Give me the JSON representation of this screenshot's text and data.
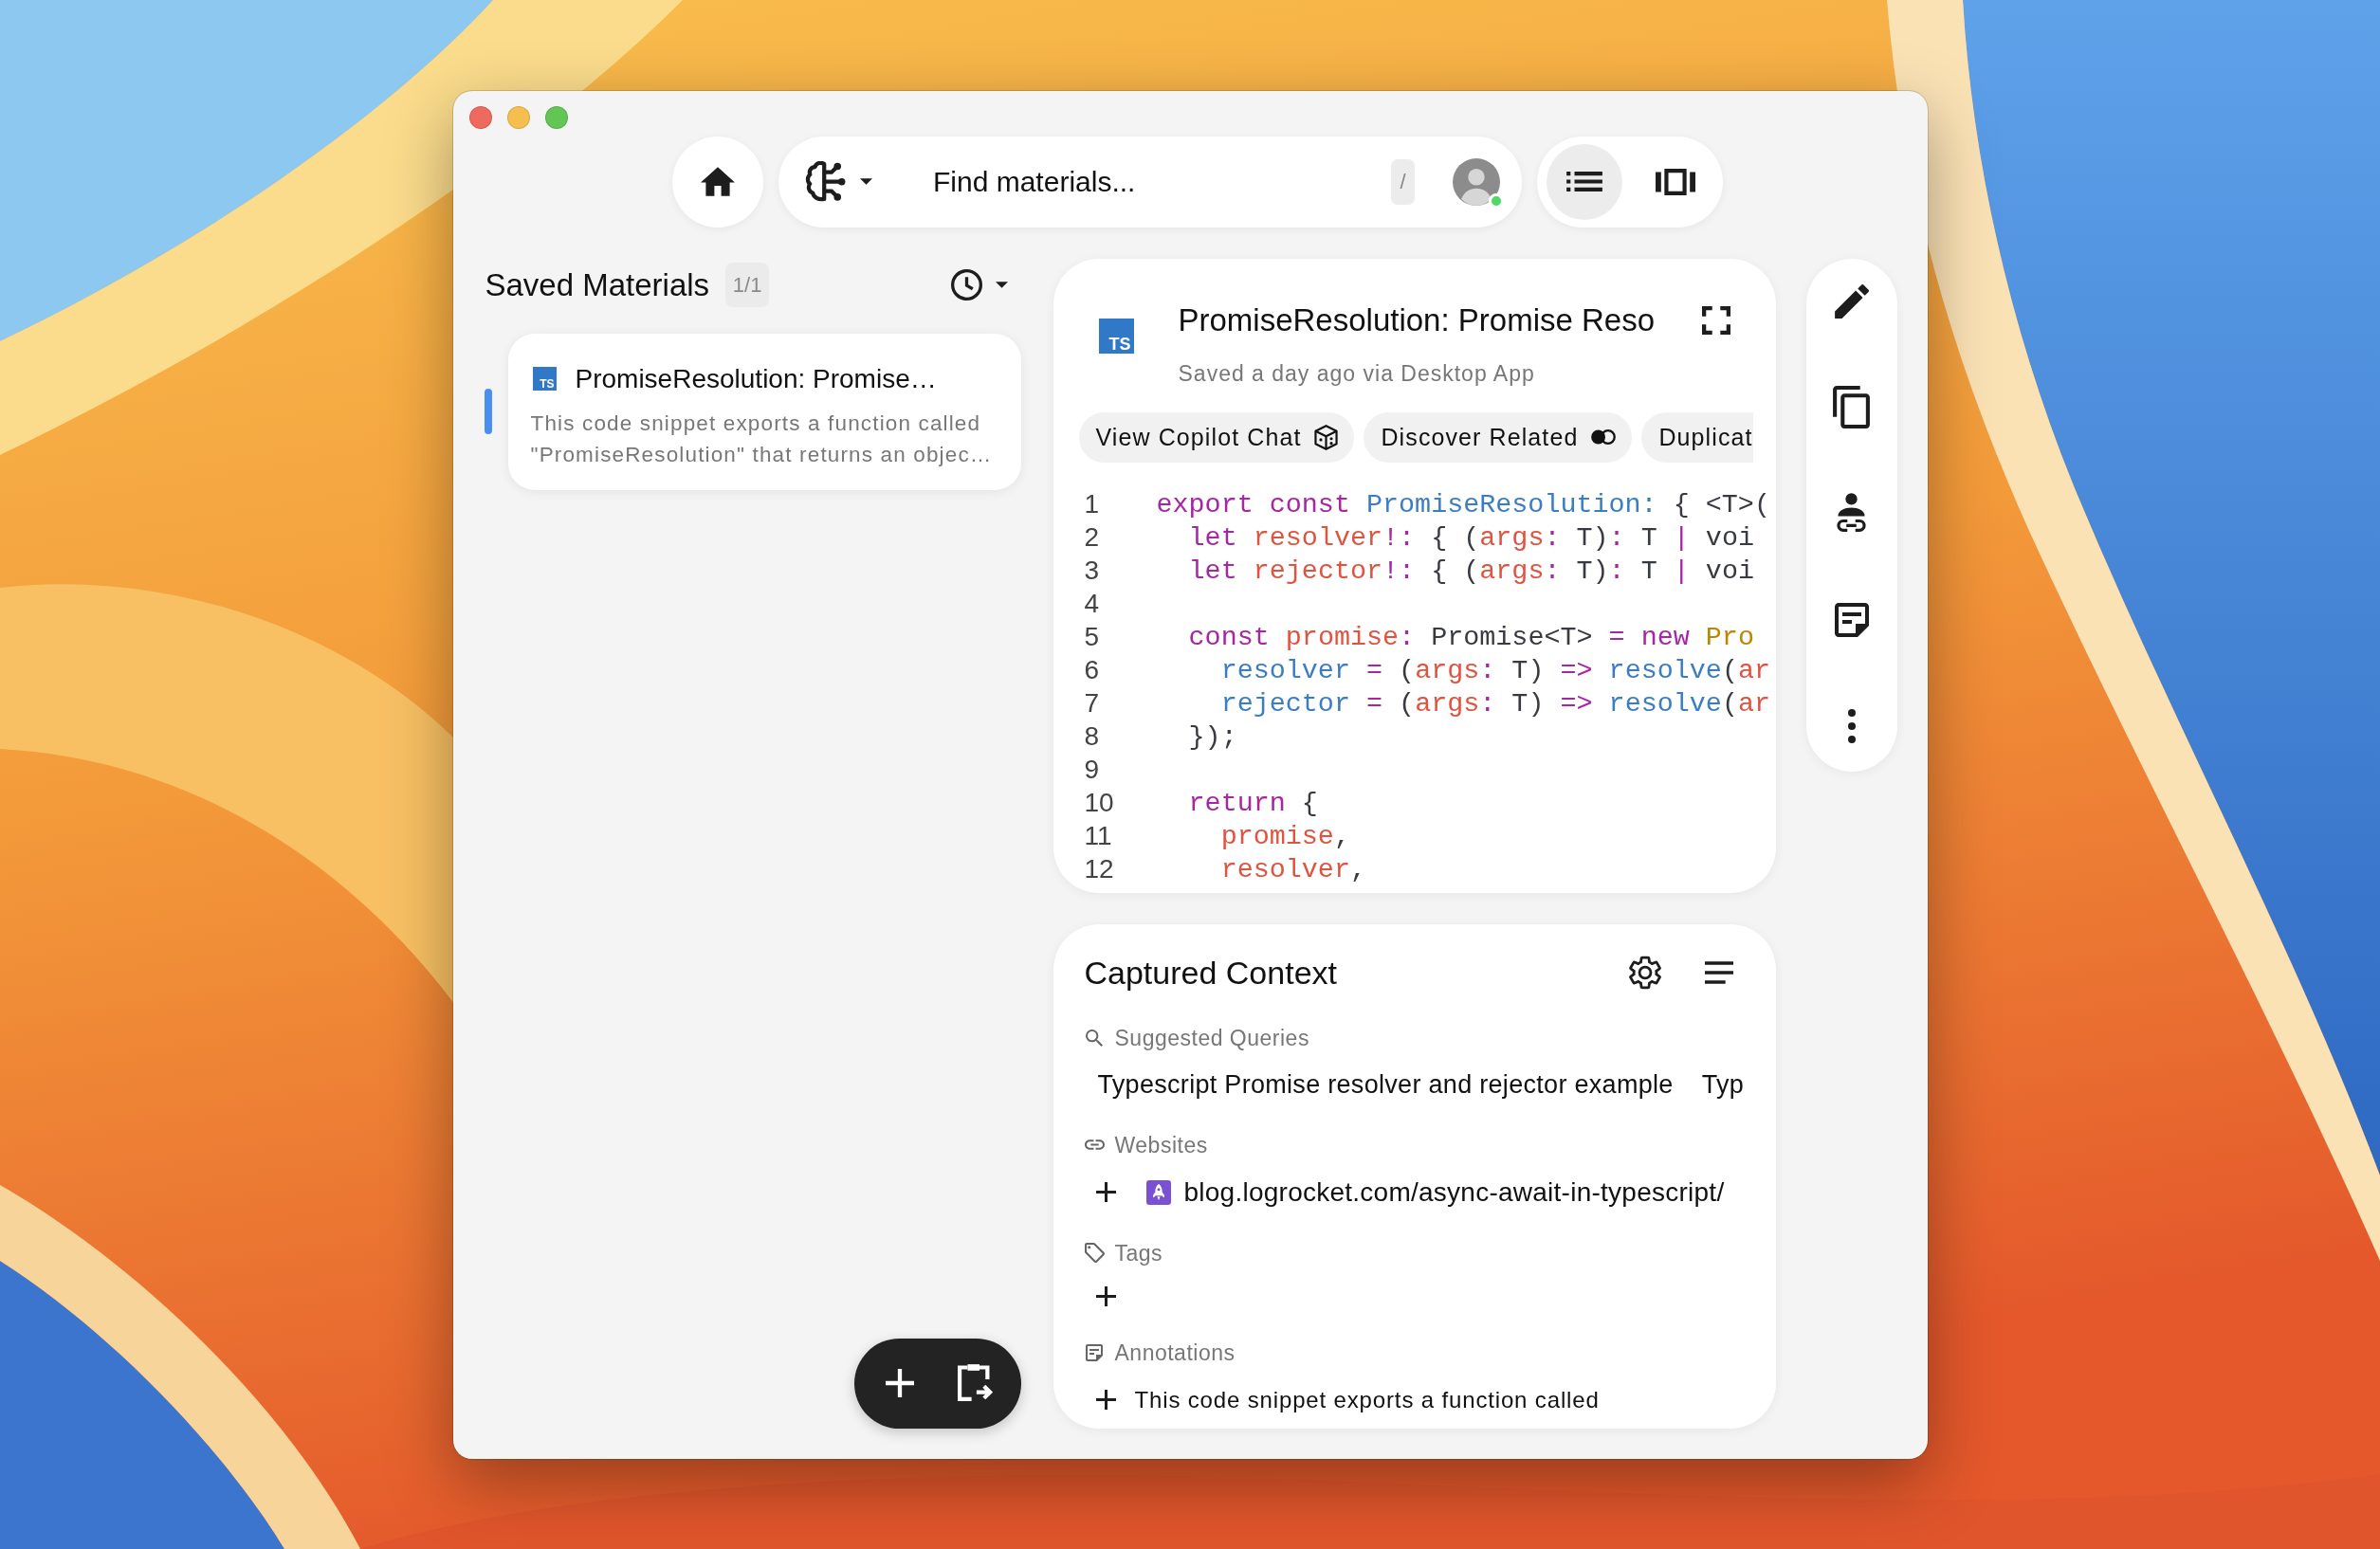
{
  "toolbar": {
    "search": {
      "placeholder": "Find materials...",
      "shortcut": "/"
    },
    "avatar": {
      "online": true
    },
    "views": [
      {
        "kind": "list",
        "selected": true
      },
      {
        "kind": "carousel",
        "selected": false
      }
    ]
  },
  "saved_materials": {
    "title": "Saved Materials",
    "count": "1/1",
    "items": [
      {
        "file_type": "TS",
        "title": "PromiseResolution: Promise…",
        "description": "This code snippet exports a function called \"PromiseResolution\" that returns an objec…",
        "selected": true
      }
    ]
  },
  "detail": {
    "file_type": "TS",
    "title": "PromiseResolution: Promise Reso",
    "saved_info": "Saved a day ago via Desktop App",
    "actions": [
      {
        "label": "View Copilot Chat",
        "kind": "copilot"
      },
      {
        "label": "Discover Related",
        "kind": "related"
      },
      {
        "label": "Duplicat",
        "kind": "plain"
      }
    ],
    "code": [
      {
        "number": "1",
        "tokens": [
          {
            "text": "export const ",
            "kind": "keyword"
          },
          {
            "text": "PromiseResolution:",
            "kind": "function"
          },
          {
            "text": " { <T>(",
            "kind": "plain"
          }
        ]
      },
      {
        "number": "2",
        "tokens": [
          {
            "text": "  let ",
            "kind": "keyword"
          },
          {
            "text": "resolver",
            "kind": "variable"
          },
          {
            "text": "!:",
            "kind": "keyword"
          },
          {
            "text": " { (",
            "kind": "plain"
          },
          {
            "text": "args",
            "kind": "variable"
          },
          {
            "text": ":",
            "kind": "keyword"
          },
          {
            "text": " T)",
            "kind": "plain"
          },
          {
            "text": ":",
            "kind": "keyword"
          },
          {
            "text": " T ",
            "kind": "plain"
          },
          {
            "text": "|",
            "kind": "keyword"
          },
          {
            "text": " voi",
            "kind": "plain"
          }
        ]
      },
      {
        "number": "3",
        "tokens": [
          {
            "text": "  let ",
            "kind": "keyword"
          },
          {
            "text": "rejector",
            "kind": "variable"
          },
          {
            "text": "!:",
            "kind": "keyword"
          },
          {
            "text": " { (",
            "kind": "plain"
          },
          {
            "text": "args",
            "kind": "variable"
          },
          {
            "text": ":",
            "kind": "keyword"
          },
          {
            "text": " T)",
            "kind": "plain"
          },
          {
            "text": ":",
            "kind": "keyword"
          },
          {
            "text": " T ",
            "kind": "plain"
          },
          {
            "text": "|",
            "kind": "keyword"
          },
          {
            "text": " voi",
            "kind": "plain"
          }
        ]
      },
      {
        "number": "4"
      },
      {
        "number": "5",
        "tokens": [
          {
            "text": "  const ",
            "kind": "keyword"
          },
          {
            "text": "promise",
            "kind": "variable"
          },
          {
            "text": ":",
            "kind": "keyword"
          },
          {
            "text": " Promise<T> ",
            "kind": "plain"
          },
          {
            "text": "= new ",
            "kind": "keyword"
          },
          {
            "text": "Pro",
            "kind": "type"
          }
        ]
      },
      {
        "number": "6",
        "tokens": [
          {
            "text": "    resolver",
            "kind": "function"
          },
          {
            "text": " = ",
            "kind": "keyword"
          },
          {
            "text": "(",
            "kind": "plain"
          },
          {
            "text": "args",
            "kind": "variable"
          },
          {
            "text": ":",
            "kind": "keyword"
          },
          {
            "text": " T) ",
            "kind": "plain"
          },
          {
            "text": "=> ",
            "kind": "keyword"
          },
          {
            "text": "resolve",
            "kind": "function"
          },
          {
            "text": "(",
            "kind": "plain"
          },
          {
            "text": "ar",
            "kind": "variable"
          }
        ]
      },
      {
        "number": "7",
        "tokens": [
          {
            "text": "    rejector",
            "kind": "function"
          },
          {
            "text": " = ",
            "kind": "keyword"
          },
          {
            "text": "(",
            "kind": "plain"
          },
          {
            "text": "args",
            "kind": "variable"
          },
          {
            "text": ":",
            "kind": "keyword"
          },
          {
            "text": " T) ",
            "kind": "plain"
          },
          {
            "text": "=> ",
            "kind": "keyword"
          },
          {
            "text": "resolve",
            "kind": "function"
          },
          {
            "text": "(",
            "kind": "plain"
          },
          {
            "text": "ar",
            "kind": "variable"
          }
        ]
      },
      {
        "number": "8",
        "tokens": [
          {
            "text": "  });",
            "kind": "plain"
          }
        ]
      },
      {
        "number": "9"
      },
      {
        "number": "10",
        "tokens": [
          {
            "text": "  return ",
            "kind": "keyword"
          },
          {
            "text": "{",
            "kind": "plain"
          }
        ]
      },
      {
        "number": "11",
        "tokens": [
          {
            "text": "    promise",
            "kind": "variable"
          },
          {
            "text": ",",
            "kind": "plain"
          }
        ]
      },
      {
        "number": "12",
        "tokens": [
          {
            "text": "    resolver",
            "kind": "variable"
          },
          {
            "text": ",",
            "kind": "plain"
          }
        ]
      }
    ]
  },
  "context": {
    "title": "Captured Context",
    "sections": [
      {
        "kind": "queries",
        "label": "Suggested Queries",
        "items": [
          "Typescript Promise resolver and rejector example",
          "Typ"
        ]
      },
      {
        "kind": "websites",
        "label": "Websites",
        "items": [
          "blog.logrocket.com/async-await-in-typescript/"
        ]
      },
      {
        "kind": "tags",
        "label": "Tags"
      },
      {
        "kind": "annotations",
        "label": "Annotations",
        "items": [
          "This code snippet exports a function called"
        ]
      }
    ]
  }
}
